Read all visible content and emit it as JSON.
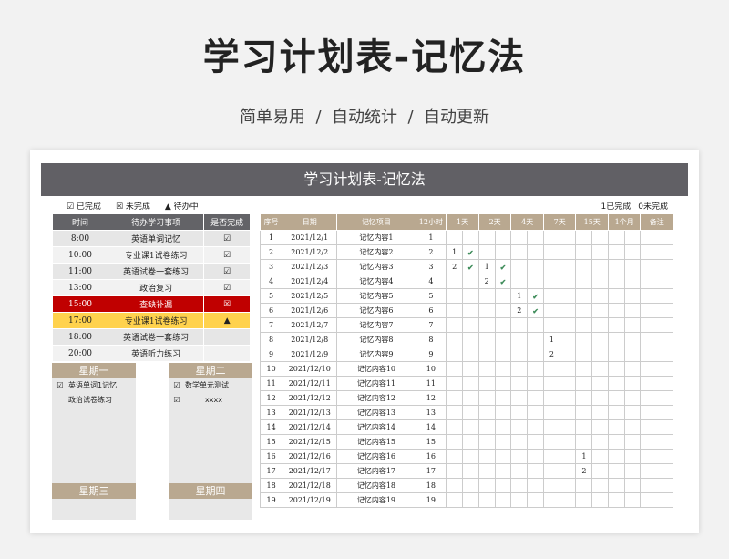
{
  "hero": {
    "title": "学习计划表-记忆法",
    "subtitle": "简单易用  /  自动统计  /  自动更新"
  },
  "sheet": {
    "banner": "学习计划表-记忆法"
  },
  "legend": {
    "done": "☑ 已完成",
    "undone": "☒ 未完成",
    "pending": "▲ 待办中"
  },
  "counts": {
    "done": "1已完成",
    "undone": "0未完成"
  },
  "tasks": {
    "headers": [
      "时间",
      "待办学习事项",
      "是否完成"
    ],
    "rows": [
      {
        "time": "8:00",
        "item": "英语单词记忆",
        "status": "☑",
        "style": ""
      },
      {
        "time": "10:00",
        "item": "专业课1试卷练习",
        "status": "☑",
        "style": "even"
      },
      {
        "time": "11:00",
        "item": "英语试卷一套练习",
        "status": "☑",
        "style": ""
      },
      {
        "time": "13:00",
        "item": "政治复习",
        "status": "☑",
        "style": "even"
      },
      {
        "time": "15:00",
        "item": "查缺补漏",
        "status": "☒",
        "style": "red"
      },
      {
        "time": "17:00",
        "item": "专业课1试卷练习",
        "status": "▲",
        "style": "yellow"
      },
      {
        "time": "18:00",
        "item": "英语试卷一套练习",
        "status": "",
        "style": ""
      },
      {
        "time": "20:00",
        "item": "英语听力练习",
        "status": "",
        "style": "even"
      }
    ]
  },
  "weeks": [
    {
      "title": "星期一",
      "items": [
        {
          "check": "☑",
          "text": "英语单词1记忆"
        },
        {
          "check": "",
          "text": "政治试卷练习"
        }
      ]
    },
    {
      "title": "星期二",
      "items": [
        {
          "check": "☑",
          "text": "数学单元测试"
        },
        {
          "check": "☑",
          "text": "xxxx"
        }
      ]
    },
    {
      "title": "星期三",
      "items": []
    },
    {
      "title": "星期四",
      "items": []
    }
  ],
  "memory": {
    "headers": [
      "序号",
      "日期",
      "记忆项目",
      "12小时",
      "1天",
      "2天",
      "4天",
      "7天",
      "15天",
      "1个月",
      "备注"
    ],
    "rows": [
      {
        "no": "1",
        "date": "2021/12/1",
        "item": "记忆内容1",
        "h12": "1",
        "cells": [
          "",
          "",
          "",
          "",
          "",
          "",
          "",
          "",
          "",
          "",
          "",
          "",
          "",
          ""
        ]
      },
      {
        "no": "2",
        "date": "2021/12/2",
        "item": "记忆内容2",
        "h12": "2",
        "cells": [
          "1",
          "✔",
          "",
          "",
          "",
          "",
          "",
          "",
          "",
          "",
          "",
          "",
          "",
          ""
        ]
      },
      {
        "no": "3",
        "date": "2021/12/3",
        "item": "记忆内容3",
        "h12": "3",
        "cells": [
          "2",
          "✔",
          "1",
          "✔",
          "",
          "",
          "",
          "",
          "",
          "",
          "",
          "",
          "",
          ""
        ]
      },
      {
        "no": "4",
        "date": "2021/12/4",
        "item": "记忆内容4",
        "h12": "4",
        "cells": [
          "",
          "",
          "2",
          "✔",
          "",
          "",
          "",
          "",
          "",
          "",
          "",
          "",
          "",
          ""
        ]
      },
      {
        "no": "5",
        "date": "2021/12/5",
        "item": "记忆内容5",
        "h12": "5",
        "cells": [
          "",
          "",
          "",
          "",
          "1",
          "✔",
          "",
          "",
          "",
          "",
          "",
          "",
          "",
          ""
        ]
      },
      {
        "no": "6",
        "date": "2021/12/6",
        "item": "记忆内容6",
        "h12": "6",
        "cells": [
          "",
          "",
          "",
          "",
          "2",
          "✔",
          "",
          "",
          "",
          "",
          "",
          "",
          "",
          ""
        ]
      },
      {
        "no": "7",
        "date": "2021/12/7",
        "item": "记忆内容7",
        "h12": "7",
        "cells": [
          "",
          "",
          "",
          "",
          "",
          "",
          "",
          "",
          "",
          "",
          "",
          "",
          "",
          ""
        ]
      },
      {
        "no": "8",
        "date": "2021/12/8",
        "item": "记忆内容8",
        "h12": "8",
        "cells": [
          "",
          "",
          "",
          "",
          "",
          "",
          "1",
          "",
          "",
          "",
          "",
          "",
          "",
          ""
        ]
      },
      {
        "no": "9",
        "date": "2021/12/9",
        "item": "记忆内容9",
        "h12": "9",
        "cells": [
          "",
          "",
          "",
          "",
          "",
          "",
          "2",
          "",
          "",
          "",
          "",
          "",
          "",
          ""
        ]
      },
      {
        "no": "10",
        "date": "2021/12/10",
        "item": "记忆内容10",
        "h12": "10",
        "cells": [
          "",
          "",
          "",
          "",
          "",
          "",
          "",
          "",
          "",
          "",
          "",
          "",
          "",
          ""
        ]
      },
      {
        "no": "11",
        "date": "2021/12/11",
        "item": "记忆内容11",
        "h12": "11",
        "cells": [
          "",
          "",
          "",
          "",
          "",
          "",
          "",
          "",
          "",
          "",
          "",
          "",
          "",
          ""
        ]
      },
      {
        "no": "12",
        "date": "2021/12/12",
        "item": "记忆内容12",
        "h12": "12",
        "cells": [
          "",
          "",
          "",
          "",
          "",
          "",
          "",
          "",
          "",
          "",
          "",
          "",
          "",
          ""
        ]
      },
      {
        "no": "13",
        "date": "2021/12/13",
        "item": "记忆内容13",
        "h12": "13",
        "cells": [
          "",
          "",
          "",
          "",
          "",
          "",
          "",
          "",
          "",
          "",
          "",
          "",
          "",
          ""
        ]
      },
      {
        "no": "14",
        "date": "2021/12/14",
        "item": "记忆内容14",
        "h12": "14",
        "cells": [
          "",
          "",
          "",
          "",
          "",
          "",
          "",
          "",
          "",
          "",
          "",
          "",
          "",
          ""
        ]
      },
      {
        "no": "15",
        "date": "2021/12/15",
        "item": "记忆内容15",
        "h12": "15",
        "cells": [
          "",
          "",
          "",
          "",
          "",
          "",
          "",
          "",
          "",
          "",
          "",
          "",
          "",
          ""
        ]
      },
      {
        "no": "16",
        "date": "2021/12/16",
        "item": "记忆内容16",
        "h12": "16",
        "cells": [
          "",
          "",
          "",
          "",
          "",
          "",
          "",
          "",
          "1",
          "",
          "",
          "",
          "",
          ""
        ]
      },
      {
        "no": "17",
        "date": "2021/12/17",
        "item": "记忆内容17",
        "h12": "17",
        "cells": [
          "",
          "",
          "",
          "",
          "",
          "",
          "",
          "",
          "2",
          "",
          "",
          "",
          "",
          ""
        ]
      },
      {
        "no": "18",
        "date": "2021/12/18",
        "item": "记忆内容18",
        "h12": "18",
        "cells": [
          "",
          "",
          "",
          "",
          "",
          "",
          "",
          "",
          "",
          "",
          "",
          "",
          "",
          ""
        ]
      },
      {
        "no": "19",
        "date": "2021/12/19",
        "item": "记忆内容19",
        "h12": "19",
        "cells": [
          "",
          "",
          "",
          "",
          "",
          "",
          "",
          "",
          "",
          "",
          "",
          "",
          "",
          ""
        ]
      }
    ]
  }
}
